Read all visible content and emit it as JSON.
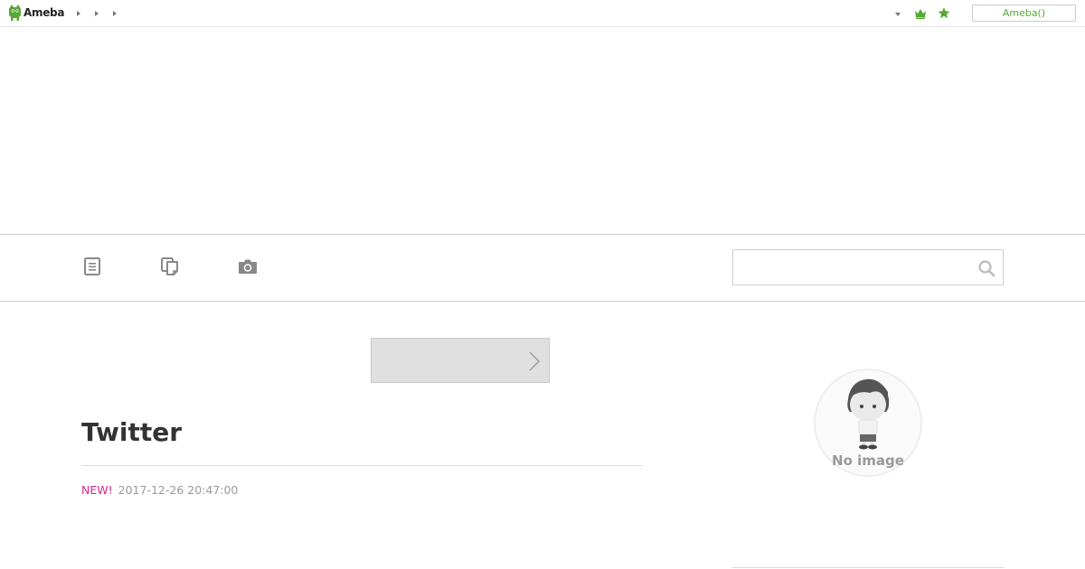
{
  "header": {
    "logo_text": "Ameba",
    "account_label": "Ameba()"
  },
  "search": {
    "value": "",
    "placeholder": ""
  },
  "pager": {
    "prev_label": ""
  },
  "entry": {
    "title": "Twitter",
    "new_label": "NEW!",
    "date": "2017-12-26 20:47:00"
  },
  "sidebar": {
    "avatar_text": "No image"
  },
  "colors": {
    "brand_green": "#58a934",
    "new_pink": "#d6268b",
    "meta_gray": "#999999"
  }
}
